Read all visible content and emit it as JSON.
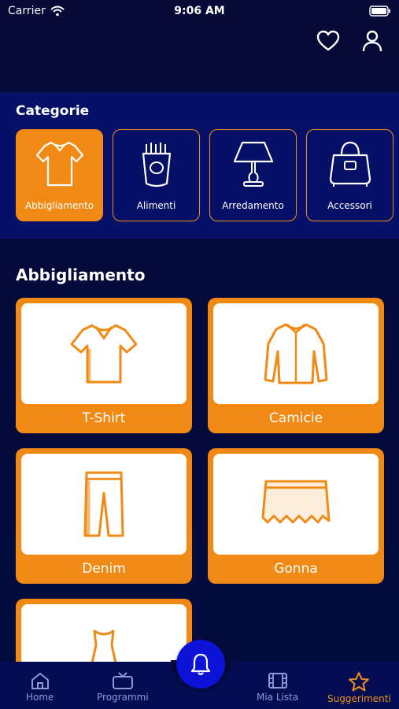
{
  "status_bar": {
    "carrier": "Carrier",
    "time": "9:06 AM"
  },
  "header": {
    "icons": [
      "heart-icon",
      "user-icon"
    ]
  },
  "categories": {
    "title": "Categorie",
    "items": [
      {
        "label": "Abbigliamento",
        "icon": "shirt-icon",
        "active": true
      },
      {
        "label": "Alimenti",
        "icon": "food-icon",
        "active": false
      },
      {
        "label": "Arredamento",
        "icon": "lamp-icon",
        "active": false
      },
      {
        "label": "Accessori",
        "icon": "bag-icon",
        "active": false
      }
    ]
  },
  "main": {
    "title": "Abbigliamento",
    "tiles": [
      {
        "label": "T-Shirt",
        "icon": "tshirt-icon"
      },
      {
        "label": "Camicie",
        "icon": "shirt-longsleeve-icon"
      },
      {
        "label": "Denim",
        "icon": "jeans-icon"
      },
      {
        "label": "Gonna",
        "icon": "skirt-icon"
      },
      {
        "label": "",
        "icon": "dress-icon"
      }
    ]
  },
  "tabbar": {
    "items": [
      {
        "label": "Home",
        "icon": "home-icon",
        "active": false
      },
      {
        "label": "Programmi",
        "icon": "tv-icon",
        "active": false
      },
      {
        "label": "Mia Lista",
        "icon": "film-icon",
        "active": false
      },
      {
        "label": "Suggerimenti",
        "icon": "star-icon",
        "active": true
      }
    ],
    "fab_icon": "bell-icon"
  },
  "colors": {
    "accent": "#f08a14",
    "background": "#050a36",
    "panel": "#061066",
    "fab": "#0d13d6",
    "tab_inactive": "#8f98d8"
  }
}
